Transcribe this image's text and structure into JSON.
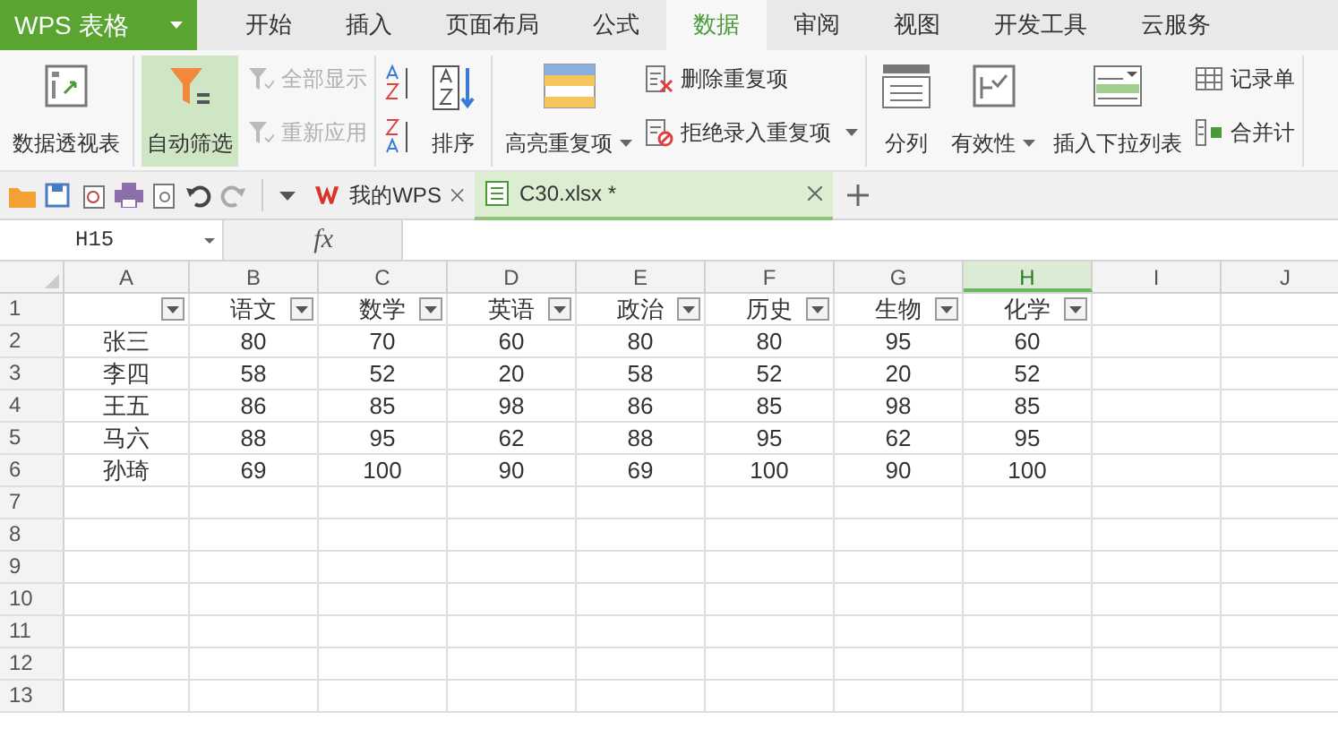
{
  "app_menu": {
    "label": "WPS 表格"
  },
  "tabs": [
    {
      "label": "开始",
      "selected": false
    },
    {
      "label": "插入",
      "selected": false
    },
    {
      "label": "页面布局",
      "selected": false
    },
    {
      "label": "公式",
      "selected": false
    },
    {
      "label": "数据",
      "selected": true
    },
    {
      "label": "审阅",
      "selected": false
    },
    {
      "label": "视图",
      "selected": false
    },
    {
      "label": "开发工具",
      "selected": false
    },
    {
      "label": "云服务",
      "selected": false
    }
  ],
  "ribbon": {
    "groups": [
      {
        "items": [
          {
            "kind": "big",
            "label": "数据透视表",
            "selected": false,
            "disabled": false,
            "dropdown": false
          }
        ]
      },
      {
        "items": [
          {
            "kind": "big",
            "label": "自动筛选",
            "selected": true,
            "disabled": false,
            "dropdown": false
          },
          {
            "kind": "stack",
            "items": [
              {
                "label": "全部显示",
                "disabled": true,
                "dropdown": false
              },
              {
                "label": "重新应用",
                "disabled": true,
                "dropdown": false
              }
            ]
          }
        ]
      },
      {
        "items": [
          {
            "kind": "sort-pair"
          },
          {
            "kind": "big",
            "label": "排序",
            "selected": false,
            "disabled": false,
            "dropdown": false
          }
        ]
      },
      {
        "items": [
          {
            "kind": "big",
            "label": "高亮重复项",
            "selected": false,
            "disabled": false,
            "dropdown": true
          },
          {
            "kind": "stack",
            "items": [
              {
                "label": "删除重复项",
                "disabled": false,
                "dropdown": false
              },
              {
                "label": "拒绝录入重复项",
                "disabled": false,
                "dropdown": true
              }
            ]
          }
        ]
      },
      {
        "items": [
          {
            "kind": "big",
            "label": "分列",
            "selected": false,
            "disabled": false,
            "dropdown": false
          },
          {
            "kind": "big",
            "label": "有效性",
            "selected": false,
            "disabled": false,
            "dropdown": true
          },
          {
            "kind": "big",
            "label": "插入下拉列表",
            "selected": false,
            "disabled": false,
            "dropdown": false
          },
          {
            "kind": "stack",
            "items": [
              {
                "label": "记录单",
                "disabled": false,
                "dropdown": false
              },
              {
                "label": "合并计",
                "disabled": false,
                "dropdown": false
              }
            ]
          }
        ]
      }
    ]
  },
  "doc_tabs": [
    {
      "label": "我的WPS",
      "kind": "home",
      "selected": false
    },
    {
      "label": "C30.xlsx *",
      "kind": "sheet",
      "selected": true
    }
  ],
  "formula_bar": {
    "name_box": "H15",
    "fx": "fx"
  },
  "sheet": {
    "columns": [
      {
        "label": "A",
        "selected": false
      },
      {
        "label": "B",
        "selected": false
      },
      {
        "label": "C",
        "selected": false
      },
      {
        "label": "D",
        "selected": false
      },
      {
        "label": "E",
        "selected": false
      },
      {
        "label": "F",
        "selected": false
      },
      {
        "label": "G",
        "selected": false
      },
      {
        "label": "H",
        "selected": true
      },
      {
        "label": "I",
        "selected": false
      },
      {
        "label": "J",
        "selected": false
      }
    ],
    "rows": [
      {
        "number": "1",
        "filter": true,
        "cells": [
          "",
          "语文",
          "数学",
          "英语",
          "政治",
          "历史",
          "生物",
          "化学"
        ]
      },
      {
        "number": "2",
        "filter": false,
        "cells": [
          "张三",
          "80",
          "70",
          "60",
          "80",
          "80",
          "95",
          "60"
        ]
      },
      {
        "number": "3",
        "filter": false,
        "cells": [
          "李四",
          "58",
          "52",
          "20",
          "58",
          "52",
          "20",
          "52"
        ]
      },
      {
        "number": "4",
        "filter": false,
        "cells": [
          "王五",
          "86",
          "85",
          "98",
          "86",
          "85",
          "98",
          "85"
        ]
      },
      {
        "number": "5",
        "filter": false,
        "cells": [
          "马六",
          "88",
          "95",
          "62",
          "88",
          "95",
          "62",
          "95"
        ]
      },
      {
        "number": "6",
        "filter": false,
        "cells": [
          "孙琦",
          "69",
          "100",
          "90",
          "69",
          "100",
          "90",
          "100"
        ]
      },
      {
        "number": "7",
        "filter": false,
        "cells": []
      },
      {
        "number": "8",
        "filter": false,
        "cells": []
      },
      {
        "number": "9",
        "filter": false,
        "cells": []
      },
      {
        "number": "10",
        "filter": false,
        "cells": []
      },
      {
        "number": "11",
        "filter": false,
        "cells": []
      },
      {
        "number": "12",
        "filter": false,
        "cells": []
      },
      {
        "number": "13",
        "filter": false,
        "cells": []
      }
    ]
  }
}
